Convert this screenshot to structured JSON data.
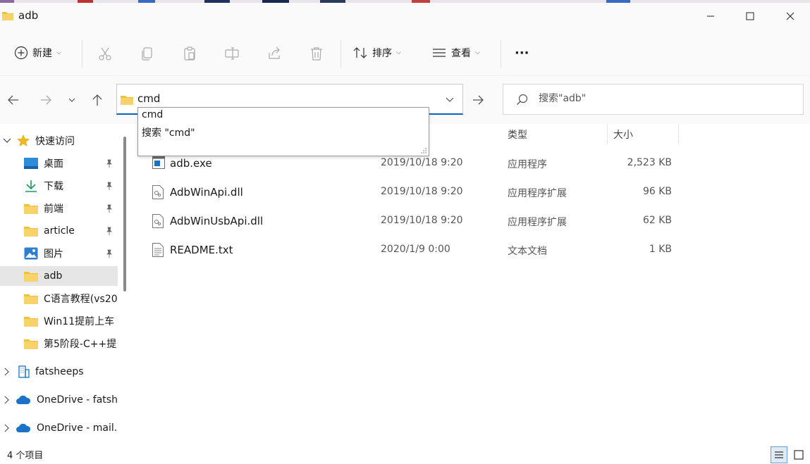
{
  "window": {
    "title": "adb"
  },
  "toolbar": {
    "new_label": "新建",
    "sort_label": "排序",
    "view_label": "查看",
    "more_label": "···"
  },
  "address": {
    "value": "cmd"
  },
  "suggestions": [
    "cmd",
    "搜索 \"cmd\""
  ],
  "search": {
    "placeholder": "搜索\"adb\""
  },
  "sidebar": {
    "quick_access": "快速访问",
    "items": [
      {
        "label": "桌面",
        "icon": "desktop-icon",
        "pinned": true
      },
      {
        "label": "下载",
        "icon": "download-icon",
        "pinned": true
      },
      {
        "label": "前端",
        "icon": "folder-icon",
        "pinned": true
      },
      {
        "label": "article",
        "icon": "folder-icon",
        "pinned": true
      },
      {
        "label": "图片",
        "icon": "pictures-icon",
        "pinned": true
      },
      {
        "label": "adb",
        "icon": "folder-icon",
        "pinned": false
      },
      {
        "label": "C语言教程(vs20",
        "icon": "folder-icon",
        "pinned": false
      },
      {
        "label": "Win11提前上车",
        "icon": "folder-icon",
        "pinned": false
      },
      {
        "label": "第5阶段-C++提",
        "icon": "folder-icon",
        "pinned": false
      }
    ],
    "roots": [
      {
        "label": "fatsheeps",
        "icon": "building-icon"
      },
      {
        "label": "OneDrive - fatsh",
        "icon": "onedrive-icon"
      },
      {
        "label": "OneDrive - mail.",
        "icon": "onedrive-icon"
      }
    ]
  },
  "columns": {
    "type": "类型",
    "size": "大小"
  },
  "files": [
    {
      "name": "adb.exe",
      "date": "2019/10/18 9:20",
      "type": "应用程序",
      "size": "2,523 KB",
      "icon": "exe-icon"
    },
    {
      "name": "AdbWinApi.dll",
      "date": "2019/10/18 9:20",
      "type": "应用程序扩展",
      "size": "96 KB",
      "icon": "dll-icon"
    },
    {
      "name": "AdbWinUsbApi.dll",
      "date": "2019/10/18 9:20",
      "type": "应用程序扩展",
      "size": "62 KB",
      "icon": "dll-icon"
    },
    {
      "name": "README.txt",
      "date": "2020/1/9 0:00",
      "type": "文本文档",
      "size": "1 KB",
      "icon": "txt-icon"
    }
  ],
  "status": {
    "count_text": "4 个项目"
  },
  "colors": {
    "accent": "#0067c0",
    "folder": "#f3c03e",
    "selection": "#e6e6e6"
  }
}
